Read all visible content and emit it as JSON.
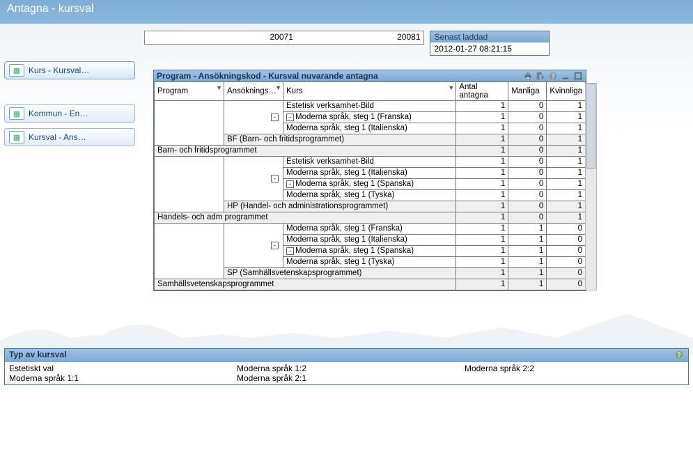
{
  "title": "Antagna - kursval",
  "periods": {
    "left": "20071",
    "right": "20081"
  },
  "loaded": {
    "label": "Senast laddad",
    "value": "2012-01-27 08:21:15"
  },
  "sidebar": {
    "items": [
      {
        "label": "Kurs - Kursval…",
        "selected": true
      },
      {
        "label": "Kommun - En…",
        "selected": false
      },
      {
        "label": "Kursval - Ans…",
        "selected": false
      }
    ]
  },
  "panel": {
    "title": "Program - Ansökningskod - Kursval nuvarande antagna",
    "columns": {
      "program": "Program",
      "ansokning": "Ansöknings…",
      "kurs": "Kurs",
      "antal": "Antal antagna",
      "manliga": "Manliga",
      "kvinnliga": "Kvinnliga"
    },
    "groups": [
      {
        "rows": [
          {
            "kurs": "Estetisk verksamhet-Bild",
            "a": 1,
            "m": 0,
            "k": 1
          },
          {
            "kurs": "Moderna språk, steg 1 (Franska)",
            "a": 1,
            "m": 0,
            "k": 1,
            "exp": true
          },
          {
            "kurs": "Moderna språk, steg 1 (Italienska)",
            "a": 1,
            "m": 0,
            "k": 1
          }
        ],
        "code": {
          "label": "BF (Barn- och fritidsprogrammet)",
          "a": 1,
          "m": 0,
          "k": 1
        },
        "sum": {
          "label": "Barn- och fritidsprogrammet",
          "a": 1,
          "m": 0,
          "k": 1
        }
      },
      {
        "rows": [
          {
            "kurs": "Estetisk verksamhet-Bild",
            "a": 1,
            "m": 0,
            "k": 1
          },
          {
            "kurs": "Moderna språk, steg 1 (Italienska)",
            "a": 1,
            "m": 0,
            "k": 1
          },
          {
            "kurs": "Moderna språk, steg 1 (Spanska)",
            "a": 1,
            "m": 0,
            "k": 1,
            "exp": true
          },
          {
            "kurs": "Moderna språk, steg 1 (Tyska)",
            "a": 1,
            "m": 0,
            "k": 1
          }
        ],
        "code": {
          "label": "HP (Handel- och administrationsprogrammet)",
          "a": 1,
          "m": 0,
          "k": 1
        },
        "sum": {
          "label": "Handels- och adm programmet",
          "a": 1,
          "m": 0,
          "k": 1
        }
      },
      {
        "rows": [
          {
            "kurs": "Moderna språk, steg 1 (Franska)",
            "a": 1,
            "m": 1,
            "k": 0
          },
          {
            "kurs": "Moderna språk, steg 1 (Italienska)",
            "a": 1,
            "m": 1,
            "k": 0
          },
          {
            "kurs": "Moderna språk, steg 1 (Spanska)",
            "a": 1,
            "m": 1,
            "k": 0,
            "exp": true
          },
          {
            "kurs": "Moderna språk, steg 1 (Tyska)",
            "a": 1,
            "m": 1,
            "k": 0
          }
        ],
        "code": {
          "label": "SP (Samhällsvetenskapsprogrammet)",
          "a": 1,
          "m": 1,
          "k": 0
        },
        "sum": {
          "label": "Samhällsvetenskapsprogrammet",
          "a": 1,
          "m": 1,
          "k": 0
        }
      }
    ]
  },
  "bottom": {
    "title": "Typ av kursval",
    "col1": [
      "Estetiskt val",
      "Moderna språk 1:1"
    ],
    "col2": [
      "Moderna språk 1:2",
      "Moderna språk 2:1"
    ],
    "col3": [
      "Moderna språk 2:2"
    ]
  }
}
